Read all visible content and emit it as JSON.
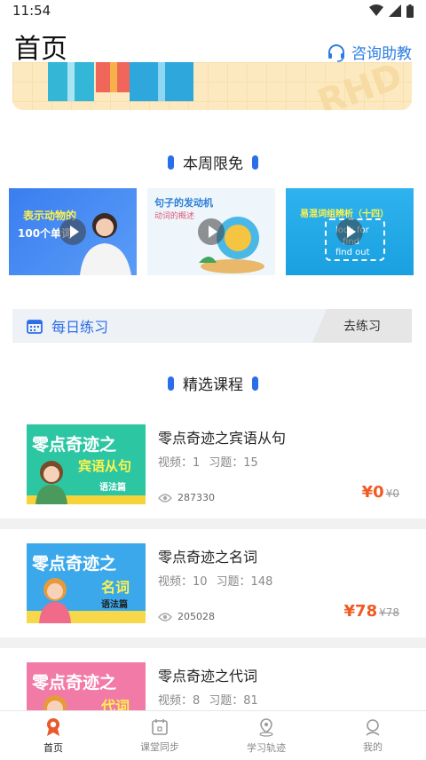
{
  "status": {
    "time": "11:54"
  },
  "header": {
    "title": "首页",
    "consult_label": "咨询助教"
  },
  "banner": {
    "watermark": "RHD"
  },
  "free_section": {
    "title": "本周限免",
    "cards": [
      {
        "line1": "表示动物的",
        "line2": "100个单词"
      },
      {
        "line1": "句子的发动机",
        "line2": "动词的概述"
      },
      {
        "line1": "易混词组辨析（十四）",
        "line2": "look for",
        "line3": "find",
        "line4": "find out"
      }
    ]
  },
  "daily": {
    "label": "每日练习",
    "button": "去练习"
  },
  "courses_section": {
    "title": "精选课程"
  },
  "courses": [
    {
      "title": "零点奇迹之宾语从句",
      "videos_label": "视频：1",
      "exercises_label": "习题：15",
      "views": "287330",
      "price": "¥0",
      "original_price": "¥0",
      "thumb_line1": "零点奇迹之",
      "thumb_line2": "宾语从句",
      "thumb_tag": "语法篇",
      "thumb_bg": "#2cc6a3"
    },
    {
      "title": "零点奇迹之名词",
      "videos_label": "视频：10",
      "exercises_label": "习题：148",
      "views": "205028",
      "price": "¥78",
      "original_price": "¥78",
      "thumb_line1": "零点奇迹之",
      "thumb_line2": "名词",
      "thumb_tag": "语法篇",
      "thumb_bg": "#3aa8ea"
    },
    {
      "title": "零点奇迹之代词",
      "videos_label": "视频：8",
      "exercises_label": "习题：81",
      "views": "",
      "price": "",
      "original_price": "",
      "thumb_line1": "零点奇迹之",
      "thumb_line2": "代词",
      "thumb_tag": "",
      "thumb_bg": "#f27aa6"
    }
  ],
  "nav": {
    "items": [
      {
        "label": "首页",
        "icon": "home-medal-icon",
        "active": true
      },
      {
        "label": "课堂同步",
        "icon": "calendar-icon",
        "active": false
      },
      {
        "label": "学习轨迹",
        "icon": "location-pin-icon",
        "active": false
      },
      {
        "label": "我的",
        "icon": "user-icon",
        "active": false
      }
    ]
  },
  "colors": {
    "accent": "#2b6fe8",
    "price": "#f05a22",
    "nav_active": "#e85a2a"
  }
}
